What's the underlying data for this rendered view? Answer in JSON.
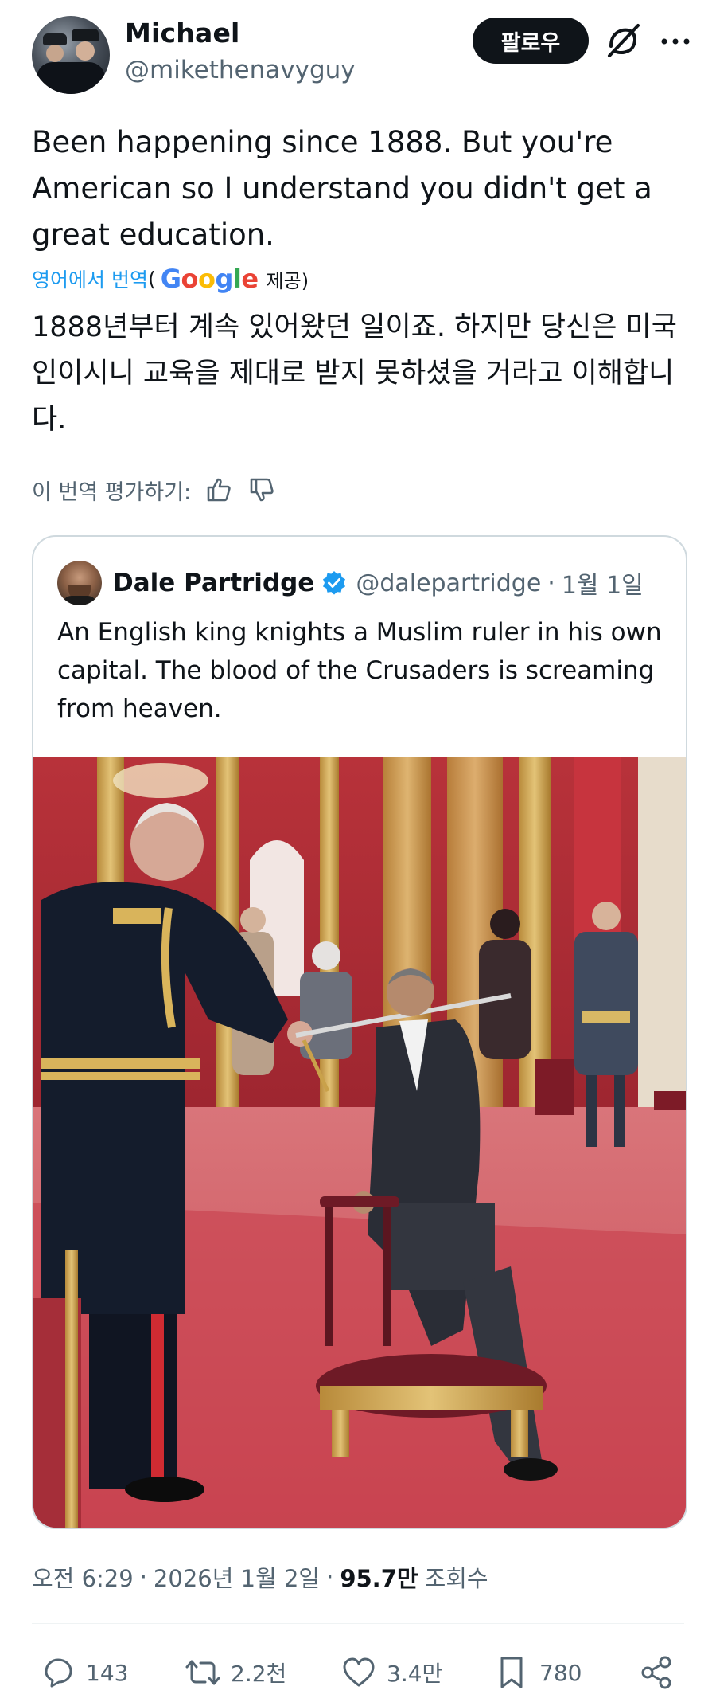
{
  "author": {
    "name": "Michael",
    "handle": "@mikethenavyguy"
  },
  "header": {
    "follow_label": "팔로우",
    "grok_icon": "grok-icon",
    "more_icon": "more-icon"
  },
  "tweet": {
    "text": "Been happening since 1888. But you're American so I understand you didn't get a great education."
  },
  "translation": {
    "source": "영어에서 번역",
    "paren_open": "(",
    "google_letters": [
      "G",
      "o",
      "o",
      "g",
      "l",
      "e"
    ],
    "provided": "제공)",
    "text": "1888년부터 계속 있어왔던 일이죠. 하지만 당신은 미국인이시니 교육을 제대로 받지 못하셨을 거라고 이해합니다.",
    "rate_label": "이 번역 평가하기:"
  },
  "quote": {
    "name": "Dale Partridge",
    "handle": "@dalepartridge",
    "separator": "·",
    "date": "1월 1일",
    "text": "An English king knights a Muslim ruler in his own capital. The blood of the Crusaders is screaming from heaven."
  },
  "meta": {
    "time": "오전 6:29",
    "sep1": "·",
    "date": "2026년 1월 2일",
    "sep2": "·",
    "views": "95.7만",
    "views_label": "조회수"
  },
  "actions": {
    "replies": "143",
    "reposts": "2.2천",
    "likes": "3.4만",
    "bookmarks": "780"
  },
  "colors": {
    "text": "#0f1419",
    "secondary": "#536471",
    "accent": "#1d9bf0",
    "border": "#cfd9de"
  }
}
